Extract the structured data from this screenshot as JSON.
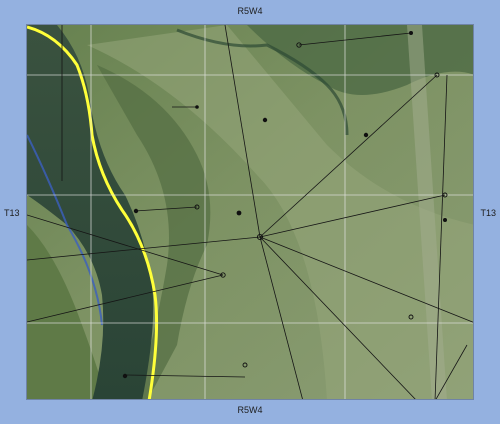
{
  "map": {
    "type": "satellite-imagery",
    "labels": {
      "top": "R5W4",
      "bottom": "R5W4",
      "left": "T13",
      "right": "T13"
    },
    "colors": {
      "frame_bg": "#94b1e0",
      "river": "#2f4a3a",
      "river_shoreline": "#ffff3a",
      "grid": "#e6e6e6",
      "link_line": "#111111"
    }
  }
}
